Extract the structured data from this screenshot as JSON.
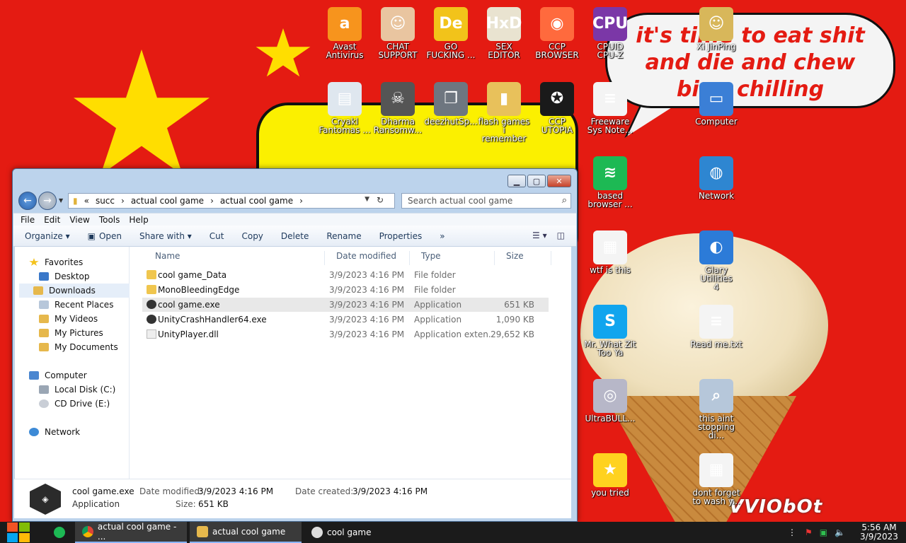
{
  "desktop": {
    "speech_text": "it's time to eat shit and die and chew bing chilling",
    "watermark": "VVIObOt",
    "icons": [
      {
        "label": "Avast\nAntivirus",
        "icon": "avast-icon",
        "color": "#f7941d",
        "glyph": "a"
      },
      {
        "label": "CHAT\nSUPPORT",
        "icon": "doctor-icon",
        "color": "#e9c5a0",
        "glyph": "☺"
      },
      {
        "label": "GO\nFUCKING ...",
        "icon": "de-icon",
        "color": "#f2c31a",
        "glyph": "De"
      },
      {
        "label": "SEX\nEDITOR",
        "icon": "hxd-icon",
        "color": "#e9e3d0",
        "glyph": "HxD"
      },
      {
        "label": "CCP\nBROWSER",
        "icon": "chrome-like-icon",
        "color": "#ff6a3d",
        "glyph": "◉"
      },
      {
        "label": "CPUID\nCPU-Z",
        "icon": "cpuz-icon",
        "color": "#7b37a7",
        "glyph": "CPU"
      },
      {
        "label": "Xi JinPing",
        "icon": "user-folder-icon",
        "color": "#d8b75a",
        "glyph": "☺"
      },
      {
        "label": "Cryakl\nFantomas ...",
        "icon": "window-app-icon",
        "color": "#dfe7ef",
        "glyph": "▤"
      },
      {
        "label": "Dharma\nRansomw...",
        "icon": "skull-icon",
        "color": "#555555",
        "glyph": "☠"
      },
      {
        "label": "deezhutSp...",
        "icon": "copies-icon",
        "color": "#6e7680",
        "glyph": "❐"
      },
      {
        "label": "flash games i\nremember",
        "icon": "folder-icon",
        "color": "#e8c15b",
        "glyph": "▮"
      },
      {
        "label": "CCP\nUTOPIA",
        "icon": "utopia-icon",
        "color": "#1a1a1a",
        "glyph": "✪"
      },
      {
        "label": "Freeware\nSys Note...",
        "icon": "document-icon",
        "color": "#f4f4f4",
        "glyph": "≡"
      },
      {
        "label": "Computer",
        "icon": "computer-icon",
        "color": "#3b7fd6",
        "glyph": "▭"
      },
      {
        "label": "based\nbrowser ...",
        "icon": "spotify-icon",
        "color": "#1db954",
        "glyph": "≋"
      },
      {
        "label": "Network",
        "icon": "network-icon",
        "color": "#2e86d1",
        "glyph": "◍"
      },
      {
        "label": "wtf is this",
        "icon": "webpage-icon",
        "color": "#f4f4f4",
        "glyph": "▦"
      },
      {
        "label": "Glary Utilities\n4",
        "icon": "glary-icon",
        "color": "#2c7bd8",
        "glyph": "◐"
      },
      {
        "label": "Mr. What Zit\nToo Ya",
        "icon": "skype-icon",
        "color": "#11a5ee",
        "glyph": "S"
      },
      {
        "label": "Read me.txt",
        "icon": "text-file-icon",
        "color": "#f4f4f4",
        "glyph": "≡"
      },
      {
        "label": "UltraBULL...",
        "icon": "disc-icon",
        "color": "#b7b7c8",
        "glyph": "◎"
      },
      {
        "label": "this aint\nstopping di...",
        "icon": "scanner-icon",
        "color": "#b6c7da",
        "glyph": "⌕"
      },
      {
        "label": "you tried",
        "icon": "star-icon",
        "color": "#ffd21f",
        "glyph": "★"
      },
      {
        "label": "dont forget\nto wash y...",
        "icon": "webpage-icon",
        "color": "#f4f4f4",
        "glyph": "▦"
      }
    ]
  },
  "window": {
    "breadcrumb_prefix": "«",
    "path": [
      "succ",
      "actual cool game",
      "actual cool game"
    ],
    "search_placeholder": "Search actual cool game",
    "menu": [
      "File",
      "Edit",
      "View",
      "Tools",
      "Help"
    ],
    "toolbar": [
      "Organize ▾",
      "Open",
      "Share with ▾",
      "Cut",
      "Copy",
      "Delete",
      "Rename",
      "Properties",
      "»"
    ],
    "nav": {
      "favorites": "Favorites",
      "desktop": "Desktop",
      "downloads": "Downloads",
      "recent": "Recent Places",
      "videos": "My Videos",
      "pictures": "My Pictures",
      "documents": "My Documents",
      "computer": "Computer",
      "local_disk": "Local Disk (C:)",
      "cd_drive": "CD Drive (E:)",
      "network": "Network"
    },
    "columns": {
      "name": "Name",
      "date": "Date modified",
      "type": "Type",
      "size": "Size"
    },
    "files": [
      {
        "name": "cool game_Data",
        "date": "3/9/2023 4:16 PM",
        "type": "File folder",
        "size": "",
        "kind": "folder"
      },
      {
        "name": "MonoBleedingEdge",
        "date": "3/9/2023 4:16 PM",
        "type": "File folder",
        "size": "",
        "kind": "folder"
      },
      {
        "name": "cool game.exe",
        "date": "3/9/2023 4:16 PM",
        "type": "Application",
        "size": "651 KB",
        "kind": "unity"
      },
      {
        "name": "UnityCrashHandler64.exe",
        "date": "3/9/2023 4:16 PM",
        "type": "Application",
        "size": "1,090 KB",
        "kind": "unity"
      },
      {
        "name": "UnityPlayer.dll",
        "date": "3/9/2023 4:16 PM",
        "type": "Application exten...",
        "size": "29,652 KB",
        "kind": "dll"
      }
    ],
    "details": {
      "name": "cool game.exe",
      "type": "Application",
      "modified_label": "Date modified:",
      "modified": "3/9/2023 4:16 PM",
      "size_label": "Size:",
      "size": "651 KB",
      "created_label": "Date created:",
      "created": "3/9/2023 4:16 PM"
    }
  },
  "taskbar": {
    "tasks": [
      "actual cool game - ...",
      "actual cool game",
      "cool game"
    ],
    "time": "5:56 AM",
    "date": "3/9/2023"
  }
}
